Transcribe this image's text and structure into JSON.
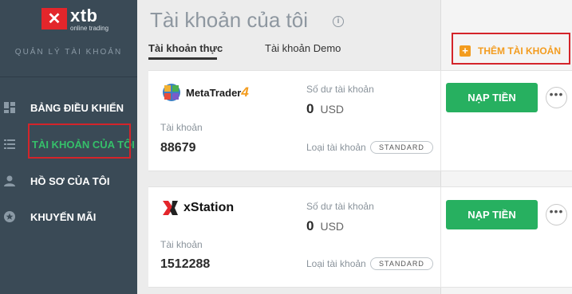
{
  "brand": {
    "logo_mark": "✕",
    "name": "xtb",
    "tagline": "online trading",
    "accent_color": "#e3262b"
  },
  "sidebar": {
    "section_title": "QUẢN LÝ TÀI KHOẢN",
    "items": [
      {
        "label": "BẢNG ĐIỀU KHIỂN",
        "icon": "dashboard-icon"
      },
      {
        "label": "TÀI KHOẢN CỦA TÔI",
        "icon": "list-icon",
        "active": true
      },
      {
        "label": "HỒ SƠ CỦA TÔI",
        "icon": "user-icon"
      },
      {
        "label": "KHUYẾN MÃI",
        "icon": "star-icon"
      }
    ]
  },
  "header": {
    "title": "Tài khoản của tôi",
    "info_icon": "i",
    "tabs": [
      {
        "label": "Tài khoản thực",
        "active": true
      },
      {
        "label": "Tài khoản Demo",
        "active": false
      }
    ],
    "add_account_label": "THÊM TÀI KHOẢN"
  },
  "accounts": [
    {
      "platform": "MetaTrader",
      "platform_suffix": "4",
      "account_label": "Tài khoản",
      "account_number": "88679",
      "balance_label": "Số dư tài khoản",
      "balance": "0",
      "currency": "USD",
      "type_label": "Loại tài khoản",
      "type": "STANDARD",
      "deposit_label": "NẠP TIỀN",
      "more_label": "•••"
    },
    {
      "platform": "xStation",
      "account_label": "Tài khoản",
      "account_number": "1512288",
      "balance_label": "Số dư tài khoản",
      "balance": "0",
      "currency": "USD",
      "type_label": "Loại tài khoản",
      "type": "STANDARD",
      "deposit_label": "NẠP TIỀN",
      "more_label": "•••"
    }
  ],
  "colors": {
    "sidebar_bg": "#3a4a56",
    "active_nav": "#35c06a",
    "deposit": "#27b060",
    "add_account": "#f39c1f",
    "highlight_box": "#d4242a"
  }
}
